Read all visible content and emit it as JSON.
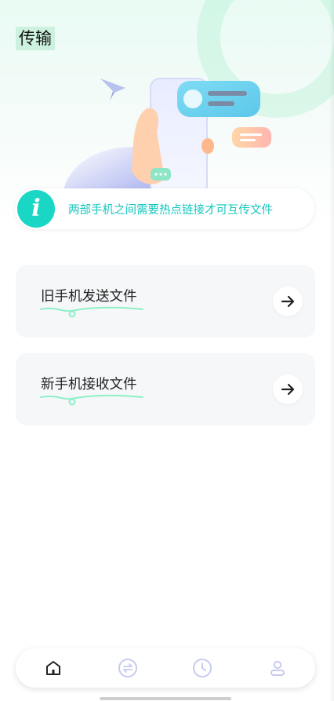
{
  "header": {
    "title": "传输"
  },
  "info": {
    "text": "两部手机之间需要热点链接才可互传文件",
    "icon_letter": "i"
  },
  "actions": [
    {
      "label": "旧手机发送文件",
      "icon": "arrow-right-icon"
    },
    {
      "label": "新手机接收文件",
      "icon": "arrow-right-icon"
    }
  ],
  "tabs": [
    {
      "icon": "home-icon",
      "active": true
    },
    {
      "icon": "transfer-icon",
      "active": false
    },
    {
      "icon": "clock-icon",
      "active": false
    },
    {
      "icon": "user-icon",
      "active": false
    }
  ],
  "colors": {
    "accent": "#19d6c5",
    "accent_text": "#14c7bd",
    "squiggle": "#8df0c8",
    "tab_inactive": "#c7cbee",
    "tab_active": "#222222"
  }
}
